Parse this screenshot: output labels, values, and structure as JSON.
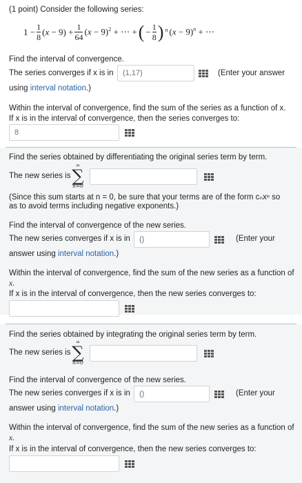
{
  "problem": {
    "header": "(1 point) Consider the following series:",
    "series_formula": "1 − (1/8)(x − 9) + (1/64)(x − 9)^2 + ⋯ + (−1/8)^n (x − 9)^n + ⋯"
  },
  "part1": {
    "heading": "Find the interval of convergence.",
    "converges_prefix": "The series converges if x is in",
    "interval_value": "(1,17)",
    "enter_note": "(Enter your answer",
    "using": "using",
    "interval_notation": "interval notation",
    "suffix": ".)",
    "sum_line1": "Within the interval of convergence, find the sum of the series as a function of x.",
    "sum_line2": "If x is in the interval of convergence, then the series converges to:",
    "sum_value": "8"
  },
  "part2": {
    "heading": "Find the series obtained by differentiating the original series term by term.",
    "new_series_label": "The new series is",
    "sigma_top": "∞",
    "sigma_bottom": "n=0",
    "note_line1": "(Since this sum starts at n = 0, be sure that your terms are of the form cₙxⁿ so",
    "note_line2": "as to avoid terms including negative exponents.)",
    "interval_heading": "Find the interval of convergence of the new series.",
    "converges_prefix": "The new series converges if x is in",
    "interval_value": "()",
    "enter_note": "(Enter your",
    "answer_using": "answer using",
    "interval_notation": "interval notation",
    "suffix": ".)",
    "sum_line1": "Within the interval of convergence, find the sum of the new series as a function of",
    "sum_line1b": "x.",
    "sum_line2": "If x is in the interval of convergence, then the new series converges to:",
    "sum_value": ""
  },
  "part3": {
    "heading": "Find the series obtained by integrating the original series term by term.",
    "new_series_label": "The new series is",
    "sigma_top": "∞",
    "sigma_bottom": "n=0",
    "interval_heading": "Find the interval of convergence of the new series.",
    "converges_prefix": "The new series converges if x is in",
    "interval_value": "()",
    "enter_note": "(Enter your",
    "answer_using": "answer using",
    "interval_notation": "interval notation",
    "suffix": ".)",
    "sum_line1": "Within the interval of convergence, find the sum of the new series as a function of",
    "sum_line1b": "x.",
    "sum_line2": "If x is in the interval of convergence, then the new series converges to:",
    "sum_value": ""
  },
  "icons": {
    "equation_editor": "matrix-grid-icon"
  },
  "colors": {
    "link": "#2a64a8",
    "section_bg": "#f4f5f6",
    "field_border": "#cfd4da",
    "divider": "#b9bec4"
  }
}
